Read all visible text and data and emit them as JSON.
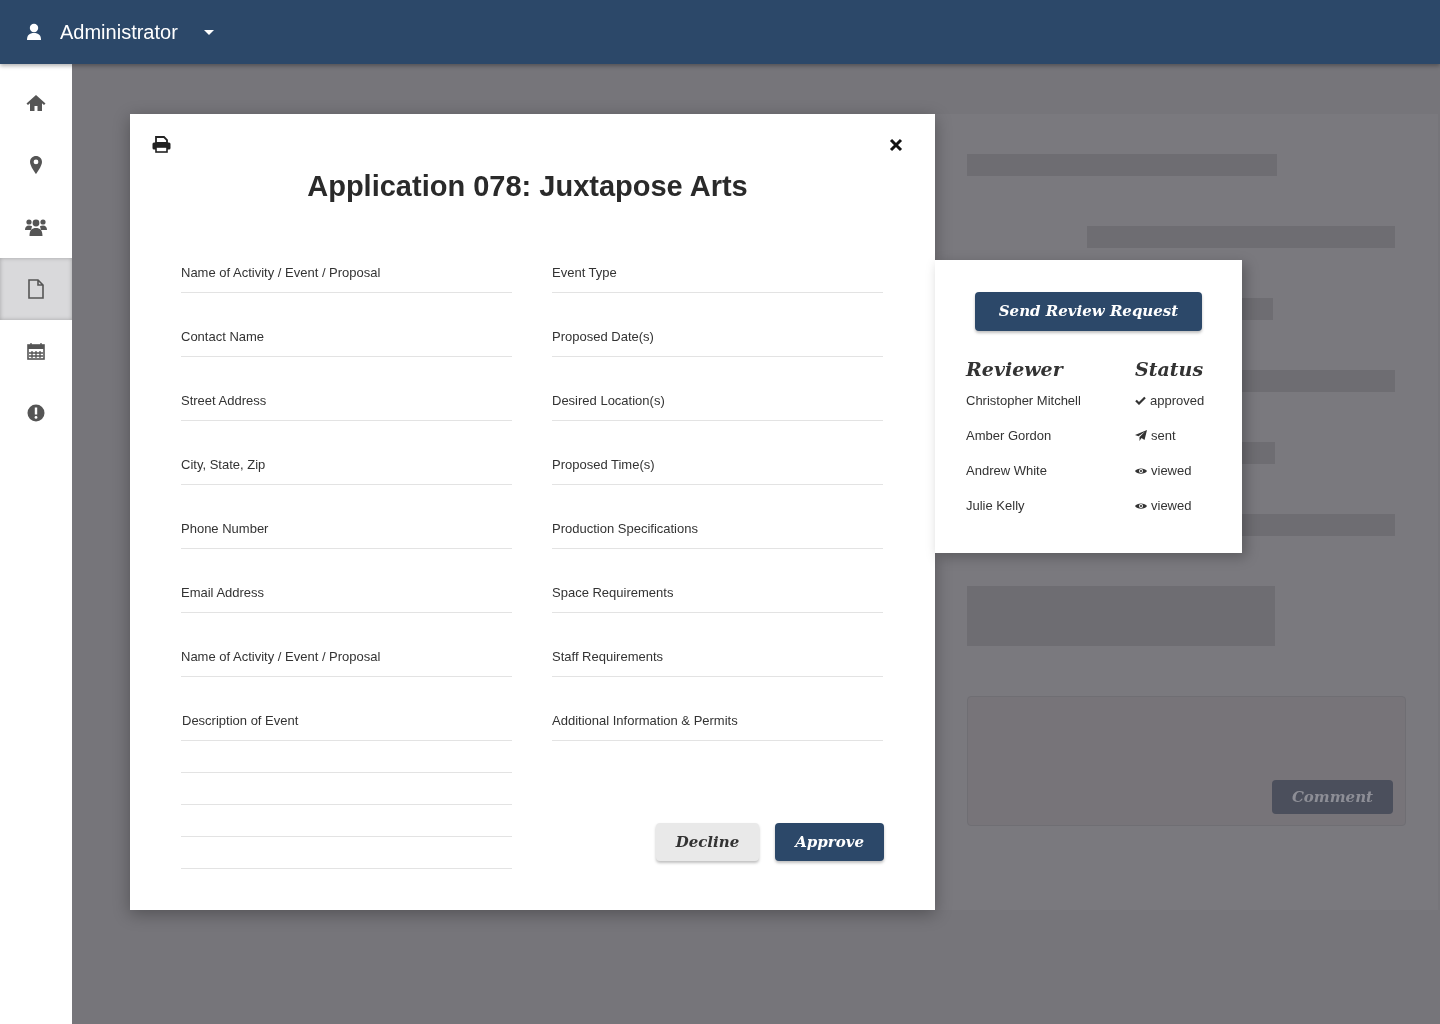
{
  "header": {
    "user": "Administrator"
  },
  "sidebar": {
    "items": [
      {
        "kind": "home",
        "selected": false
      },
      {
        "kind": "pin",
        "selected": false
      },
      {
        "kind": "users",
        "selected": false
      },
      {
        "kind": "file",
        "selected": true
      },
      {
        "kind": "calendar",
        "selected": false
      },
      {
        "kind": "alert",
        "selected": false
      }
    ]
  },
  "background": {
    "comment_button": "Comment"
  },
  "modal": {
    "title": "Application 078: Juxtapose Arts",
    "left_fields": [
      {
        "kind": "field",
        "placeholder": "Name of Activity / Event / Proposal"
      },
      {
        "kind": "field",
        "placeholder": "Contact Name"
      },
      {
        "kind": "field",
        "placeholder": "Street Address"
      },
      {
        "kind": "field",
        "placeholder": "City, State, Zip"
      },
      {
        "kind": "field",
        "placeholder": "Phone Number"
      },
      {
        "kind": "field",
        "placeholder": "Email Address"
      },
      {
        "kind": "field",
        "placeholder": "Name of Activity / Event / Proposal"
      },
      {
        "kind": "field",
        "placeholder": "Description of Event"
      },
      {
        "kind": "blank"
      },
      {
        "kind": "blank"
      },
      {
        "kind": "blank"
      },
      {
        "kind": "blank"
      }
    ],
    "right_fields": [
      {
        "kind": "field",
        "placeholder": "Event Type"
      },
      {
        "kind": "field",
        "placeholder": "Proposed Date(s)"
      },
      {
        "kind": "field",
        "placeholder": "Desired Location(s)"
      },
      {
        "kind": "field",
        "placeholder": "Proposed Time(s)"
      },
      {
        "kind": "field",
        "placeholder": "Production Specifications"
      },
      {
        "kind": "field",
        "placeholder": "Space Requirements"
      },
      {
        "kind": "field",
        "placeholder": "Staff Requirements"
      },
      {
        "kind": "field",
        "placeholder": "Additional Information & Permits"
      }
    ],
    "buttons": [
      {
        "kind": "secondary",
        "label": "Decline"
      },
      {
        "kind": "primary",
        "label": "Approve"
      }
    ]
  },
  "review_panel": {
    "button": "Send Review Request",
    "columns": [
      "Reviewer",
      "Status"
    ],
    "rows": [
      {
        "reviewer": "Christopher Mitchell",
        "kind": "check",
        "status": "approved"
      },
      {
        "reviewer": "Amber Gordon",
        "kind": "send",
        "status": "sent"
      },
      {
        "reviewer": "Andrew White",
        "kind": "eye",
        "status": "viewed"
      },
      {
        "reviewer": "Julie Kelly",
        "kind": "eye",
        "status": "viewed"
      }
    ]
  }
}
